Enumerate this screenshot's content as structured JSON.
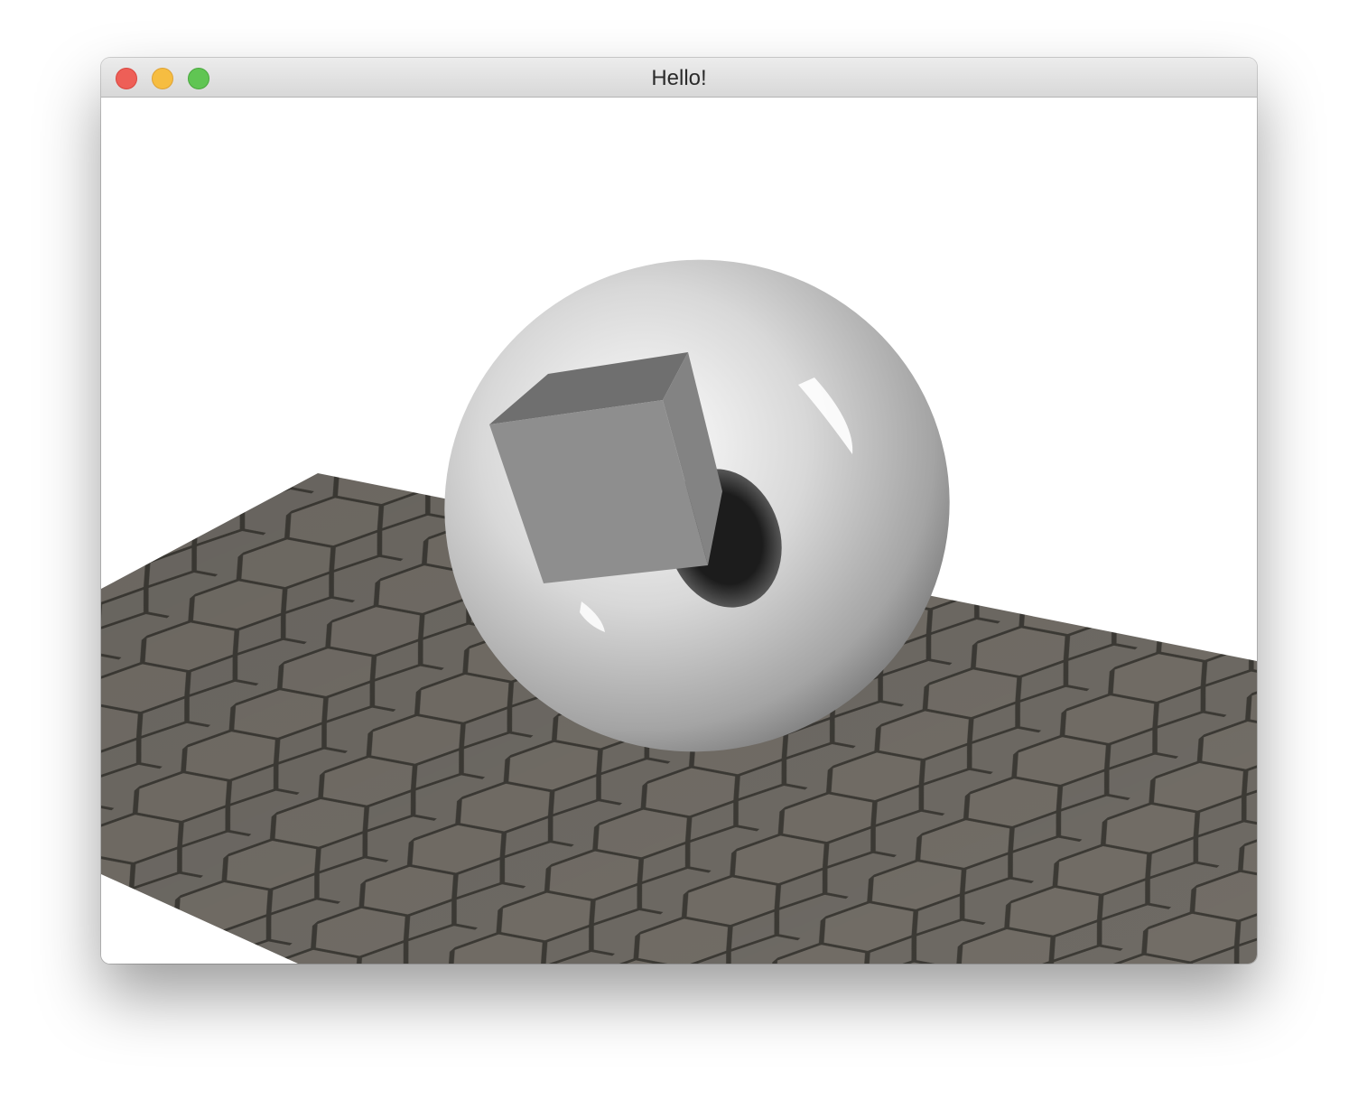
{
  "window": {
    "title": "Hello!",
    "buttons": {
      "close": "close-button",
      "minimize": "minimize-button",
      "zoom": "zoom-button"
    }
  },
  "scene": {
    "background_color": "#ffffff",
    "ground_color": "#6e6a64",
    "tile_grout_color": "#3c3a35",
    "torus_color": "#c8c8c8",
    "cube_color": "#8e8e8e"
  }
}
